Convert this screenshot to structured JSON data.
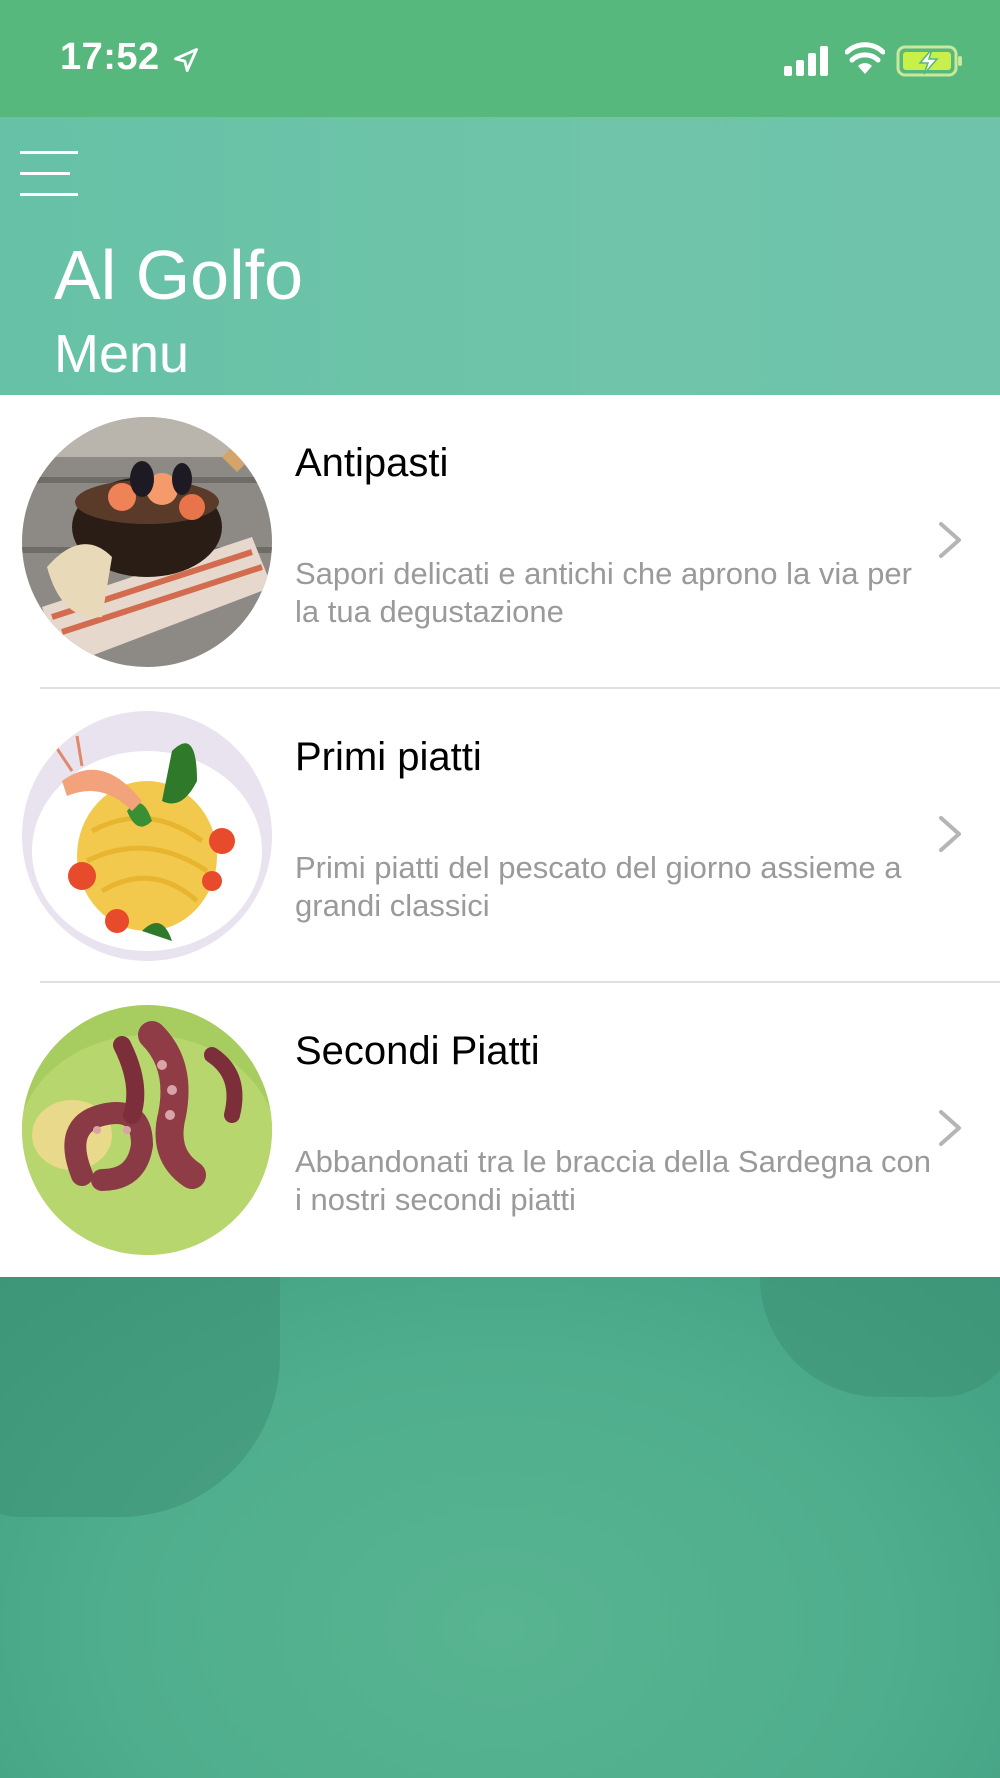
{
  "status_bar": {
    "time": "17:52"
  },
  "header": {
    "restaurant_name": "Al Golfo",
    "subtitle": "Menu"
  },
  "menu_items": [
    {
      "title": "Antipasti",
      "description": "Sapori delicati e antichi che aprono la via per la tua degustazione"
    },
    {
      "title": "Primi piatti",
      "description": "Primi piatti del pescato del giorno assieme a grandi classici"
    },
    {
      "title": "Secondi Piatti",
      "description": "Abbandonati tra le braccia della Sardegna con i nostri secondi piatti"
    }
  ],
  "colors": {
    "status_bar": "#56b87c",
    "header": "#66c1a6",
    "background": "#4fae8d",
    "description_text": "#9a9a9a"
  },
  "icons": [
    "location-arrow-icon",
    "signal-icon",
    "wifi-icon",
    "battery-charging-icon",
    "hamburger-menu-icon",
    "chevron-right-icon"
  ]
}
